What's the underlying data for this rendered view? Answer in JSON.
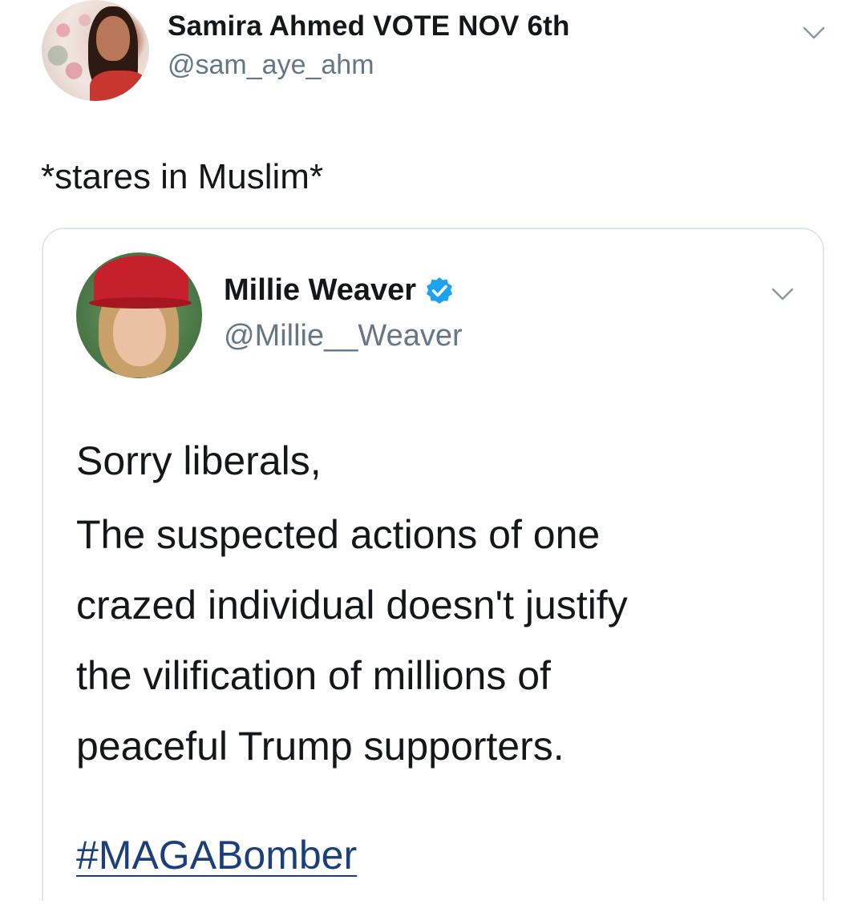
{
  "tweet": {
    "author": {
      "name": "Samira Ahmed VOTE NOV 6th",
      "handle": "@sam_aye_ahm"
    },
    "text": "*stares in Muslim*",
    "menu_icon": "chevron-down-icon"
  },
  "quoted_tweet": {
    "author": {
      "name": "Millie Weaver",
      "handle": "@Millie__Weaver",
      "verified": true
    },
    "body": {
      "line_1": "Sorry liberals,",
      "lines": [
        "The suspected actions of one",
        "crazed individual doesn't justify",
        "the vilification of millions of",
        "peaceful Trump supporters."
      ]
    },
    "hashtag": "#MAGABomber",
    "menu_icon": "chevron-down-icon"
  },
  "colors": {
    "text": "#14171a",
    "secondary_text": "#657786",
    "verified_blue": "#1da1f2",
    "hashtag": "#1b3f7a",
    "card_border": "#e1e8ed"
  }
}
